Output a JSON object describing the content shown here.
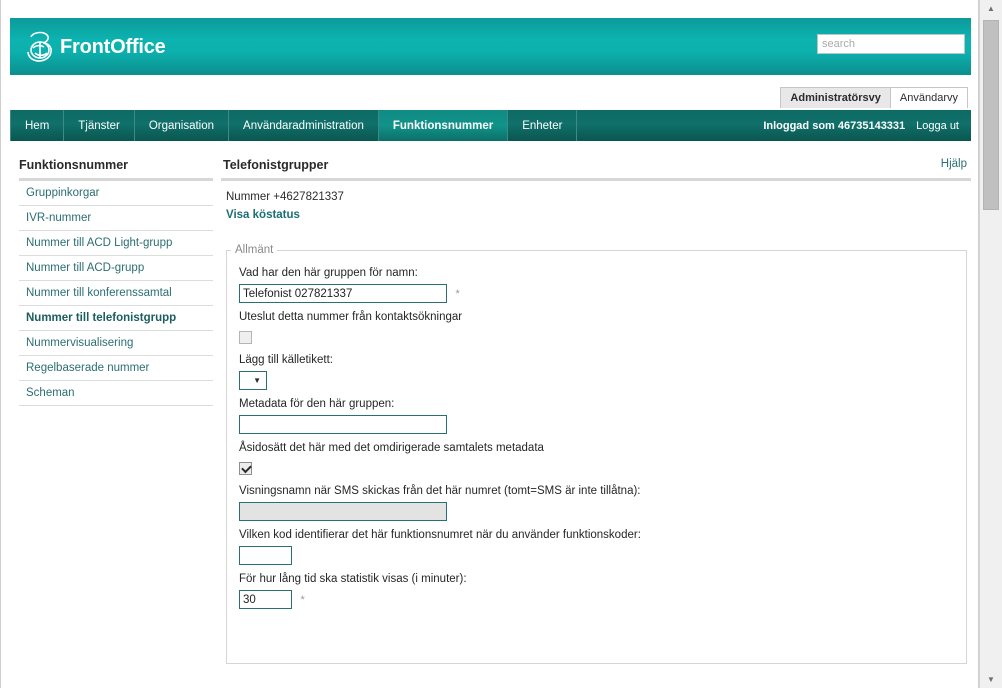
{
  "header": {
    "brand_name": "FrontOffice",
    "logo_icon": "three-swirl-logo",
    "search_placeholder": "search",
    "search_value": ""
  },
  "view_tabs": [
    {
      "label": "Administratörsvy",
      "active": true
    },
    {
      "label": "Användarvy",
      "active": false
    }
  ],
  "nav": {
    "items": [
      {
        "label": "Hem",
        "active": false
      },
      {
        "label": "Tjänster",
        "active": false
      },
      {
        "label": "Organisation",
        "active": false
      },
      {
        "label": "Användaradministration",
        "active": false
      },
      {
        "label": "Funktionsnummer",
        "active": true
      },
      {
        "label": "Enheter",
        "active": false
      }
    ],
    "logged_in_as": "Inloggad som 46735143331",
    "logout_label": "Logga ut"
  },
  "sidebar": {
    "title": "Funktionsnummer",
    "items": [
      {
        "label": "Gruppinkorgar",
        "active": false
      },
      {
        "label": "IVR-nummer",
        "active": false
      },
      {
        "label": "Nummer till ACD Light-grupp",
        "active": false
      },
      {
        "label": "Nummer till ACD-grupp",
        "active": false
      },
      {
        "label": "Nummer till konferenssamtal",
        "active": false
      },
      {
        "label": "Nummer till telefonistgrupp",
        "active": true
      },
      {
        "label": "Nummervisualisering",
        "active": false
      },
      {
        "label": "Regelbaserade nummer",
        "active": false
      },
      {
        "label": "Scheman",
        "active": false
      }
    ]
  },
  "main": {
    "title": "Telefonistgrupper",
    "help_label": "Hjälp",
    "number_line": "Nummer +4627821337",
    "queue_status_link": "Visa köstatus",
    "fieldset_legend": "Allmänt",
    "fields": {
      "group_name": {
        "label": "Vad har den här gruppen för namn:",
        "value": "Telefonist 027821337",
        "required_mark": "*"
      },
      "exclude_from_search": {
        "label": "Uteslut detta nummer från kontaktsökningar",
        "checked": false
      },
      "source_label": {
        "label": "Lägg till källetikett:",
        "selected": ""
      },
      "metadata": {
        "label": "Metadata för den här gruppen:",
        "value": ""
      },
      "override_metadata": {
        "label": "Åsidosätt det här med det omdirigerade samtalets metadata",
        "checked": true
      },
      "sms_display_name": {
        "label": "Visningsnamn när SMS skickas från det här numret (tomt=SMS är inte tillåtna):",
        "value": ""
      },
      "function_code": {
        "label": "Vilken kod identifierar det här funktionsnumret när du använder funktionskoder:",
        "value": ""
      },
      "stats_minutes": {
        "label": "För hur lång tid ska statistik visas (i minuter):",
        "value": "30",
        "required_mark": "*"
      }
    }
  },
  "scrollbar": {
    "up_arrow": "▲",
    "down_arrow": "▼"
  },
  "colors": {
    "banner_teal": "#0cb3b0",
    "nav_dark_teal": "#0e6a64",
    "nav_active_teal": "#11938a",
    "link_teal": "#2b6e73",
    "field_border": "#2a6f72"
  }
}
